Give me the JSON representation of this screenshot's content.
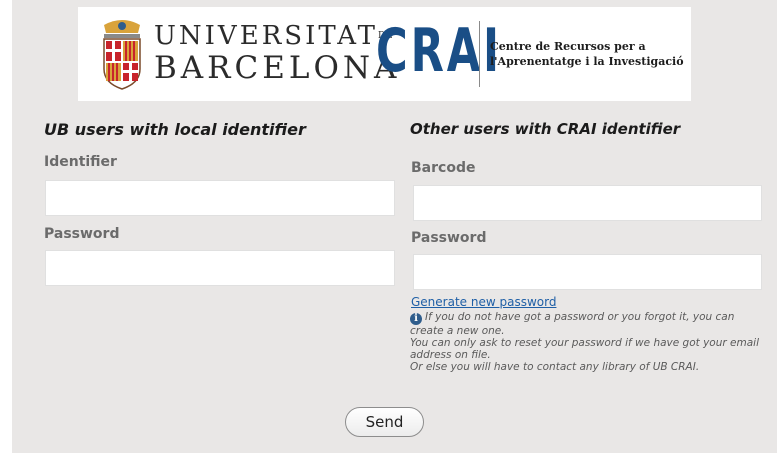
{
  "header": {
    "university_line1": "UNIVERSITAT",
    "university_de": "DE",
    "university_line2": "BARCELONA",
    "crai_logo": "CRAI",
    "crai_line1": "Centre de Recursos per a",
    "crai_line2": "l'Aprenentatge i la Investigació"
  },
  "left_column": {
    "title": "UB users with local identifier",
    "identifier_label": "Identifier",
    "identifier_value": "",
    "password_label": "Password",
    "password_value": ""
  },
  "right_column": {
    "title": "Other users with CRAI identifier",
    "barcode_label": "Barcode",
    "barcode_value": "",
    "password_label": "Password",
    "password_value": "",
    "generate_link": "Generate new password",
    "help_icon": "info-icon",
    "help_line1": "If you do not have got a password or you forgot it, you can create a new one.",
    "help_line2": "You can only ask to reset your password if we have got your email address on file.",
    "help_line3": "Or else you will have to contact any library of UB CRAI."
  },
  "actions": {
    "send_label": "Send"
  },
  "colors": {
    "panel_bg": "#e9e7e6",
    "crai_blue": "#1a4e86",
    "link": "#1f5fa6",
    "crest_red": "#c8242b",
    "crest_gold": "#d9a33b"
  }
}
